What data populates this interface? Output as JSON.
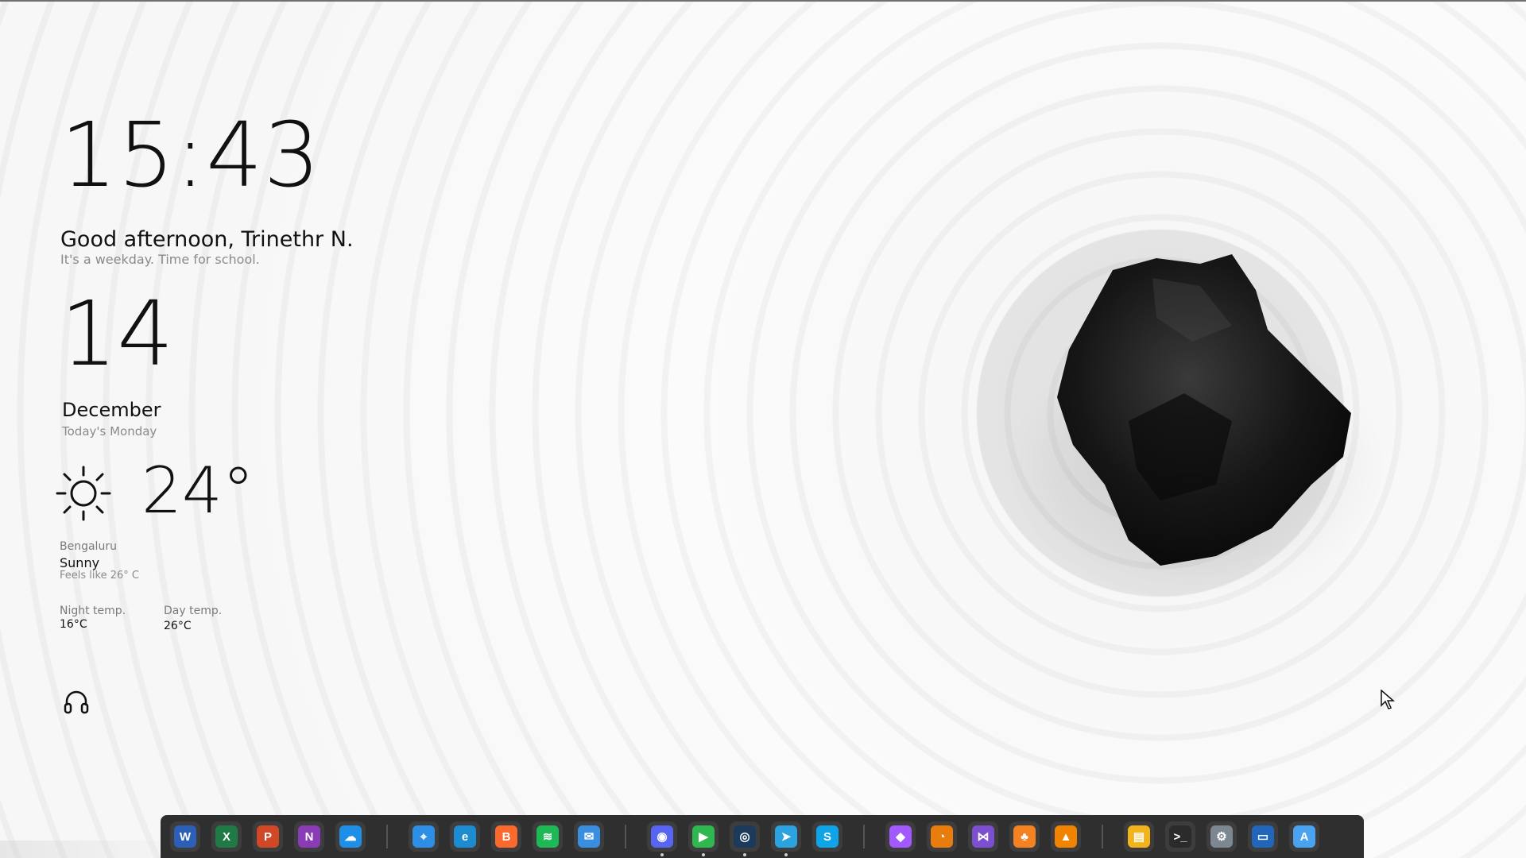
{
  "clock": {
    "time": "15:43"
  },
  "greeting": {
    "title": "Good afternoon, Trinethr N.",
    "subtitle": "It's a weekday. Time for school."
  },
  "date": {
    "day": "14",
    "month": "December",
    "weekday_text": "Today's Monday"
  },
  "weather": {
    "icon": "sun-icon",
    "temperature": "24°",
    "city": "Bengaluru",
    "condition": "Sunny",
    "feels_like": "Feels like 26° C",
    "night_label": "Night temp.",
    "night_value": "16°C",
    "day_label": "Day temp.",
    "day_value": "26°C"
  },
  "media": {
    "icon": "headphones-icon"
  },
  "dock": {
    "groups": [
      [
        {
          "name": "word",
          "glyph": "W",
          "color": "#2b5fb8",
          "running": false
        },
        {
          "name": "excel",
          "glyph": "X",
          "color": "#1f7a45",
          "running": false
        },
        {
          "name": "powerpoint",
          "glyph": "P",
          "color": "#d24726",
          "running": false
        },
        {
          "name": "onenote",
          "glyph": "N",
          "color": "#8a3bb5",
          "running": false
        },
        {
          "name": "onedrive",
          "glyph": "☁",
          "color": "#1d8fe6",
          "running": false
        }
      ],
      [
        {
          "name": "safari",
          "glyph": "⌖",
          "color": "#2d8ee6",
          "running": false
        },
        {
          "name": "edge",
          "glyph": "e",
          "color": "#1c8bd0",
          "running": false
        },
        {
          "name": "brave",
          "glyph": "B",
          "color": "#fb6a2c",
          "running": false
        },
        {
          "name": "spotify",
          "glyph": "≋",
          "color": "#1db954",
          "running": false
        },
        {
          "name": "mail",
          "glyph": "✉",
          "color": "#3a8ee0",
          "running": false
        }
      ],
      [
        {
          "name": "discord",
          "glyph": "◉",
          "color": "#5865f2",
          "running": true
        },
        {
          "name": "facetime",
          "glyph": "▶",
          "color": "#2eb84f",
          "running": true
        },
        {
          "name": "steam",
          "glyph": "◎",
          "color": "#1b3a5c",
          "running": true
        },
        {
          "name": "telegram",
          "glyph": "➤",
          "color": "#2aa3e0",
          "running": true
        },
        {
          "name": "skype",
          "glyph": "S",
          "color": "#0fa3e8",
          "running": false
        }
      ],
      [
        {
          "name": "figma",
          "glyph": "◆",
          "color": "#a259ff",
          "running": false
        },
        {
          "name": "blender",
          "glyph": "◔",
          "color": "#e87d0d",
          "running": false
        },
        {
          "name": "visual-studio",
          "glyph": "⋈",
          "color": "#7c4fd1",
          "running": false
        },
        {
          "name": "fl-studio",
          "glyph": "♣",
          "color": "#f58220",
          "running": false
        },
        {
          "name": "vlc",
          "glyph": "▲",
          "color": "#f08400",
          "running": false
        }
      ],
      [
        {
          "name": "file-explorer",
          "glyph": "▤",
          "color": "#f2b41a",
          "running": false
        },
        {
          "name": "terminal",
          "glyph": ">_",
          "color": "#2b2b2b",
          "running": false
        },
        {
          "name": "settings",
          "glyph": "⚙",
          "color": "#7d8792",
          "running": false
        },
        {
          "name": "windows-terminal",
          "glyph": "▭",
          "color": "#2266bb",
          "running": false
        },
        {
          "name": "app-store",
          "glyph": "A",
          "color": "#4aa3f0",
          "running": false
        }
      ]
    ]
  }
}
